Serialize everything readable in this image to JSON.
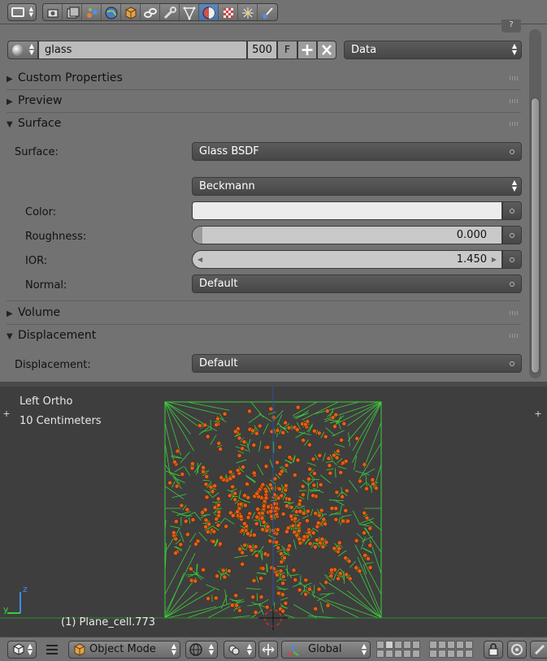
{
  "header_tabs": [
    {
      "name": "render-icon",
      "active": false
    },
    {
      "name": "render-layers-icon",
      "active": false
    },
    {
      "name": "scene-icon",
      "active": false
    },
    {
      "name": "world-icon",
      "active": false
    },
    {
      "name": "object-icon",
      "active": false
    },
    {
      "name": "constraints-icon",
      "active": false
    },
    {
      "name": "modifiers-icon",
      "active": false
    },
    {
      "name": "data-icon",
      "active": false
    },
    {
      "name": "material-icon",
      "active": true
    },
    {
      "name": "texture-icon",
      "active": false
    },
    {
      "name": "particles-icon",
      "active": false
    },
    {
      "name": "physics-icon",
      "active": false
    }
  ],
  "material": {
    "name": "glass",
    "users": "500",
    "fake_user": "F",
    "link": "Data"
  },
  "panels": {
    "custom_properties": "Custom Properties",
    "preview": "Preview",
    "surface": "Surface",
    "volume": "Volume",
    "displacement": "Displacement"
  },
  "surface": {
    "surface_label": "Surface:",
    "surface_value": "Glass BSDF",
    "distribution": "Beckmann",
    "color_label": "Color:",
    "roughness_label": "Roughness:",
    "roughness_value": "0.000",
    "roughness_fraction": 0.0,
    "ior_label": "IOR:",
    "ior_value": "1.450",
    "normal_label": "Normal:",
    "normal_value": "Default",
    "color_hex": "#ececec"
  },
  "displacement": {
    "label": "Displacement:",
    "value": "Default"
  },
  "viewport": {
    "view_name": "Left Ortho",
    "scale": "10 Centimeters",
    "object_info": "(1) Plane_cell.773",
    "axis_z": "z",
    "axis_y": "y"
  },
  "bottom_bar": {
    "mode": "Object Mode",
    "orientation": "Global"
  },
  "colors": {
    "panel_bg": "#727272",
    "viewport_bg": "#3e3e3e",
    "active_tab": "#5a88c0",
    "wire": "#3ccd3c",
    "points": "#e0601a"
  }
}
